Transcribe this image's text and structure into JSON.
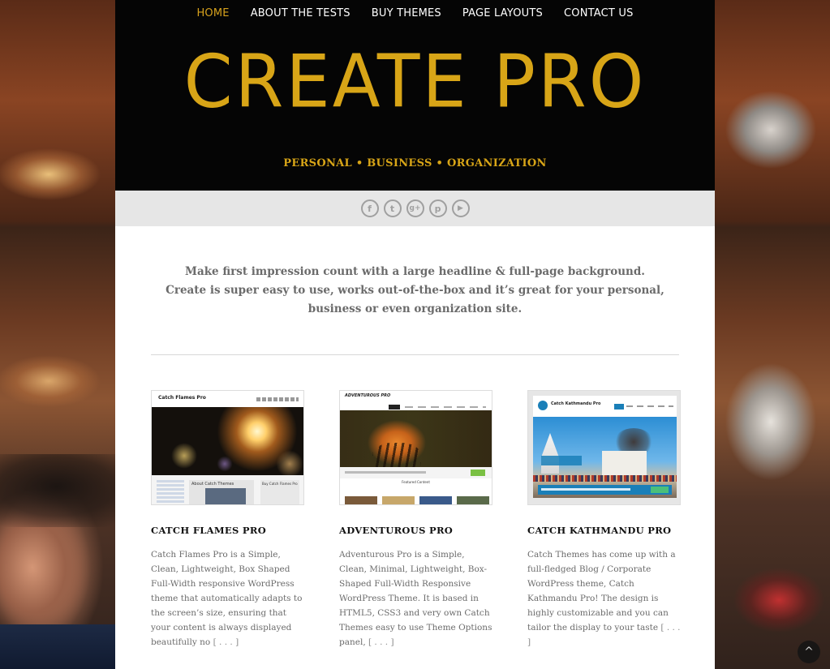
{
  "nav": {
    "items": [
      {
        "label": "HOME",
        "active": true
      },
      {
        "label": "ABOUT THE TESTS"
      },
      {
        "label": "BUY THEMES"
      },
      {
        "label": "PAGE LAYOUTS"
      },
      {
        "label": "CONTACT US"
      }
    ]
  },
  "header": {
    "title": "CREATE PRO",
    "tagline": "PERSONAL • BUSINESS • ORGANIZATION"
  },
  "social": [
    {
      "icon": "facebook-icon",
      "glyph": "f"
    },
    {
      "icon": "twitter-icon",
      "glyph": "t"
    },
    {
      "icon": "google-plus-icon",
      "glyph": "g+"
    },
    {
      "icon": "pinterest-icon",
      "glyph": "p"
    },
    {
      "icon": "youtube-icon",
      "glyph": "▶"
    }
  ],
  "intro": {
    "line1": "Make first impression count with a large headline & full-page background.",
    "line2": "Create is super easy to use, works out-of-the-box and it’s great for your personal, business or even organization site."
  },
  "cards": [
    {
      "title": "CATCH FLAMES PRO",
      "text": "Catch Flames Pro is a Simple, Clean, Lightweight, Box Shaped Full-Width responsive WordPress theme that automatically adapts to the screen’s size, ensuring that your content is always displayed beautifully no",
      "more": "[ . . . ]",
      "thumb": {
        "brand": "Catch Flames Pro",
        "section": "About Catch Themes",
        "side": "Buy Catch Flames Pro"
      }
    },
    {
      "title": "ADVENTUROUS PRO",
      "text": "Adventurous Pro is a Simple, Clean, Minimal, Lightweight, Box-Shaped Full-Width Responsive WordPress Theme. It is based in HTML5, CSS3 and very own Catch Themes easy to use Theme Options panel,",
      "more": "[ . . . ]",
      "thumb": {
        "brand": "ADVENTUROUS PRO",
        "section": "Featured Content"
      }
    },
    {
      "title": "CATCH KATHMANDU PRO",
      "text": "Catch Themes has come up with a full-fledged Blog / Corporate WordPress theme, Catch Kathmandu Pro! The design is highly customizable and you can tailor the display to your taste",
      "more": "[ . . . ]",
      "thumb": {
        "brand": "Catch Kathmandu Pro"
      }
    }
  ],
  "colors": {
    "accent": "#d8a517",
    "header_bg": "#050505",
    "social_bar_bg": "#e6e6e6",
    "body_text": "#6b6b6b"
  },
  "scroll_top": {
    "icon": "chevron-up-icon",
    "glyph": "^"
  }
}
